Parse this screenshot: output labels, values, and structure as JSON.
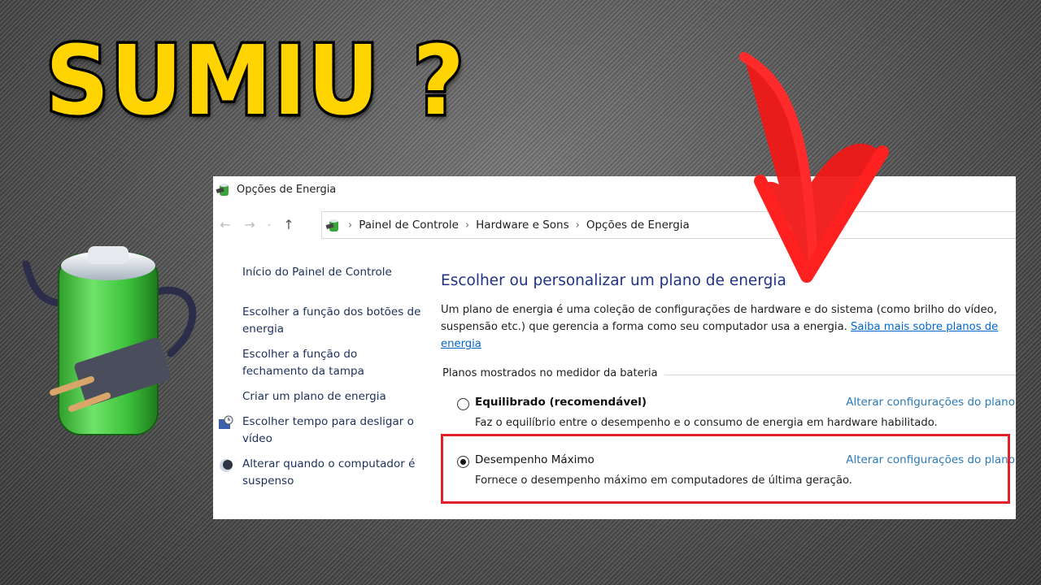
{
  "overlay": {
    "headline": "SUMIU ?",
    "headline_color": "#ffd400",
    "annotation_color": "#e0202a",
    "battery_icon": "battery-plug-icon",
    "arrow_icon": "red-arrow-down-icon"
  },
  "window": {
    "title": "Opções de Energia",
    "app_icon": "power-options-icon",
    "nav": {
      "back": "←",
      "forward": "→",
      "recent": "⌄",
      "up": "↑"
    },
    "breadcrumb": [
      {
        "label": "Painel de Controle"
      },
      {
        "label": "Hardware e Sons"
      },
      {
        "label": "Opções de Energia"
      }
    ],
    "breadcrumb_separator": "›"
  },
  "sidebar": {
    "items": [
      {
        "label": "Início do Painel de Controle"
      },
      {
        "label": "Escolher a função dos botões de energia"
      },
      {
        "label": "Escolher a função do fechamento da tampa"
      },
      {
        "label": "Criar um plano de energia"
      },
      {
        "label": "Escolher tempo para desligar o vídeo",
        "icon": "display-clock-icon"
      },
      {
        "label": "Alterar quando o computador é suspenso",
        "icon": "moon-sleep-icon"
      }
    ]
  },
  "main": {
    "title": "Escolher ou personalizar um plano de energia",
    "description": "Um plano de energia é uma coleção de configurações de hardware e do sistema (como brilho do vídeo, suspensão etc.) que gerencia a forma como seu computador usa a energia. ",
    "learn_more_link": "Saiba mais sobre planos de energia",
    "group_label": "Planos mostrados no medidor da bateria",
    "plans": [
      {
        "name": "Equilibrado (recomendável)",
        "selected": false,
        "change_link": "Alterar configurações do plano",
        "description": "Faz o equilíbrio entre o desempenho e o consumo de energia em hardware habilitado."
      },
      {
        "name": "Desempenho Máximo",
        "selected": true,
        "change_link": "Alterar configurações do plano",
        "description": "Fornece o desempenho máximo em computadores de última geração."
      }
    ]
  }
}
